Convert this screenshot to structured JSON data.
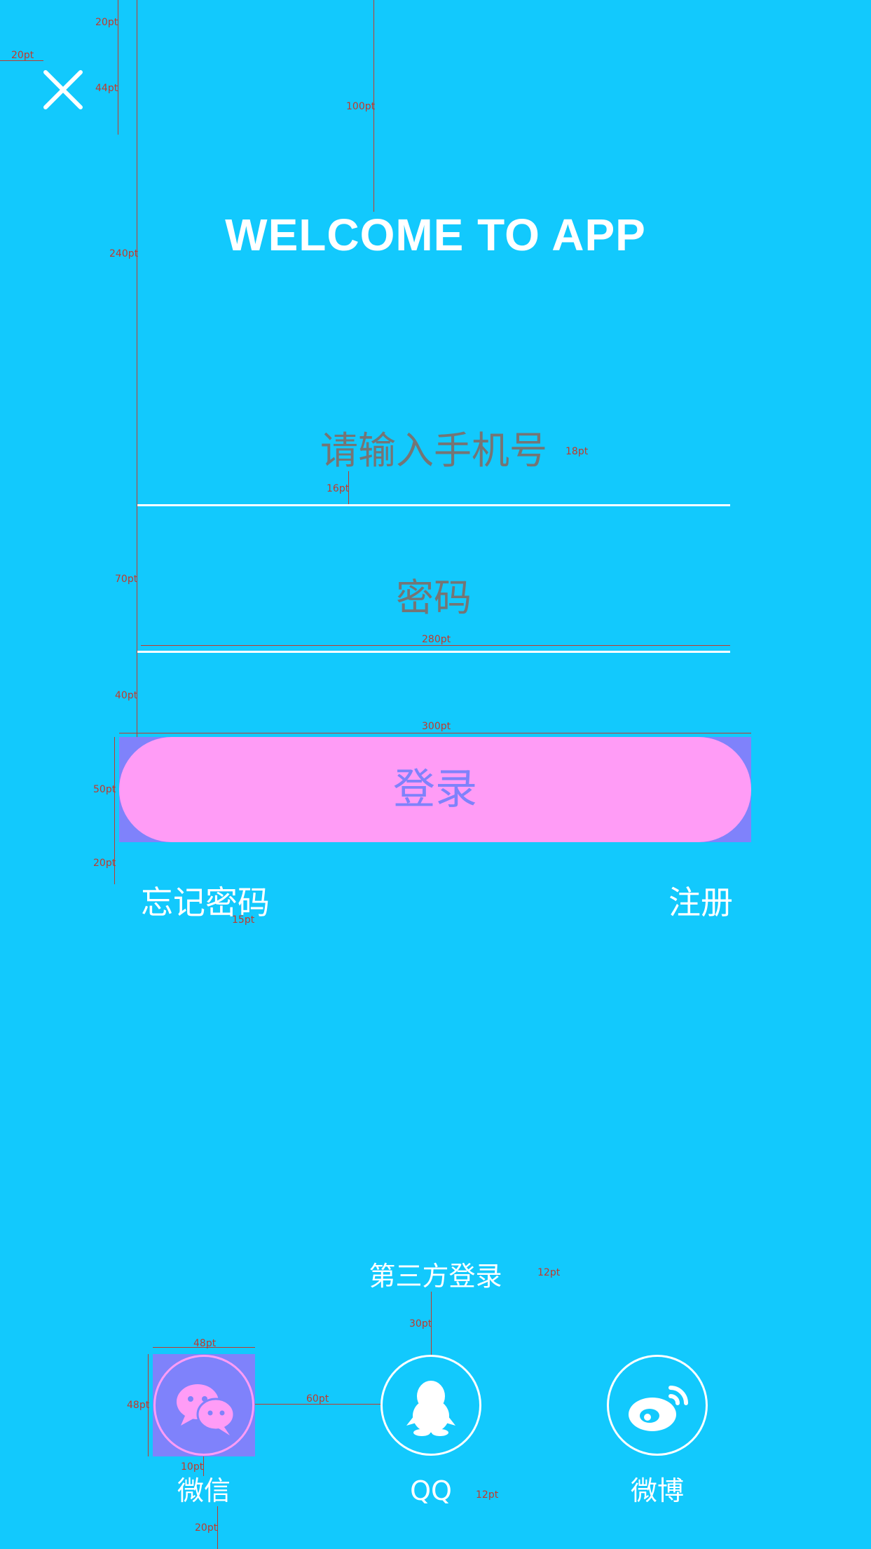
{
  "header": {
    "close_icon": "close-icon",
    "title": "WELCOME TO APP"
  },
  "form": {
    "phone_placeholder": "请输入手机号",
    "password_placeholder": "密码",
    "login_label": "登录",
    "forgot_label": "忘记密码",
    "register_label": "注册"
  },
  "third_party": {
    "title": "第三方登录",
    "providers": [
      {
        "label": "微信",
        "icon": "wechat-icon"
      },
      {
        "label": "QQ",
        "icon": "qq-icon"
      },
      {
        "label": "微博",
        "icon": "weibo-icon"
      }
    ]
  },
  "annotations": {
    "close_left": "20pt",
    "close_top": "20pt",
    "close_size": "44pt",
    "title_top": "100pt",
    "phone_top": "240pt",
    "font_18": "18pt",
    "text_gap": "16pt",
    "field_gap": "70pt",
    "field_width": "280pt",
    "button_gap": "40pt",
    "button_width": "300pt",
    "button_height": "50pt",
    "button_font": "20pt",
    "links_gap": "20pt",
    "links_font": "15pt",
    "third_font": "12pt",
    "icons_gap": "30pt",
    "icon_width": "48pt",
    "icon_height": "48pt",
    "icon_spacing": "60pt",
    "label_gap": "10pt",
    "label_font": "12pt",
    "bottom_gap": "20pt"
  },
  "colors": {
    "background": "#12c9fd",
    "button": "#ff9cf6",
    "highlight": "#7f82fb"
  }
}
